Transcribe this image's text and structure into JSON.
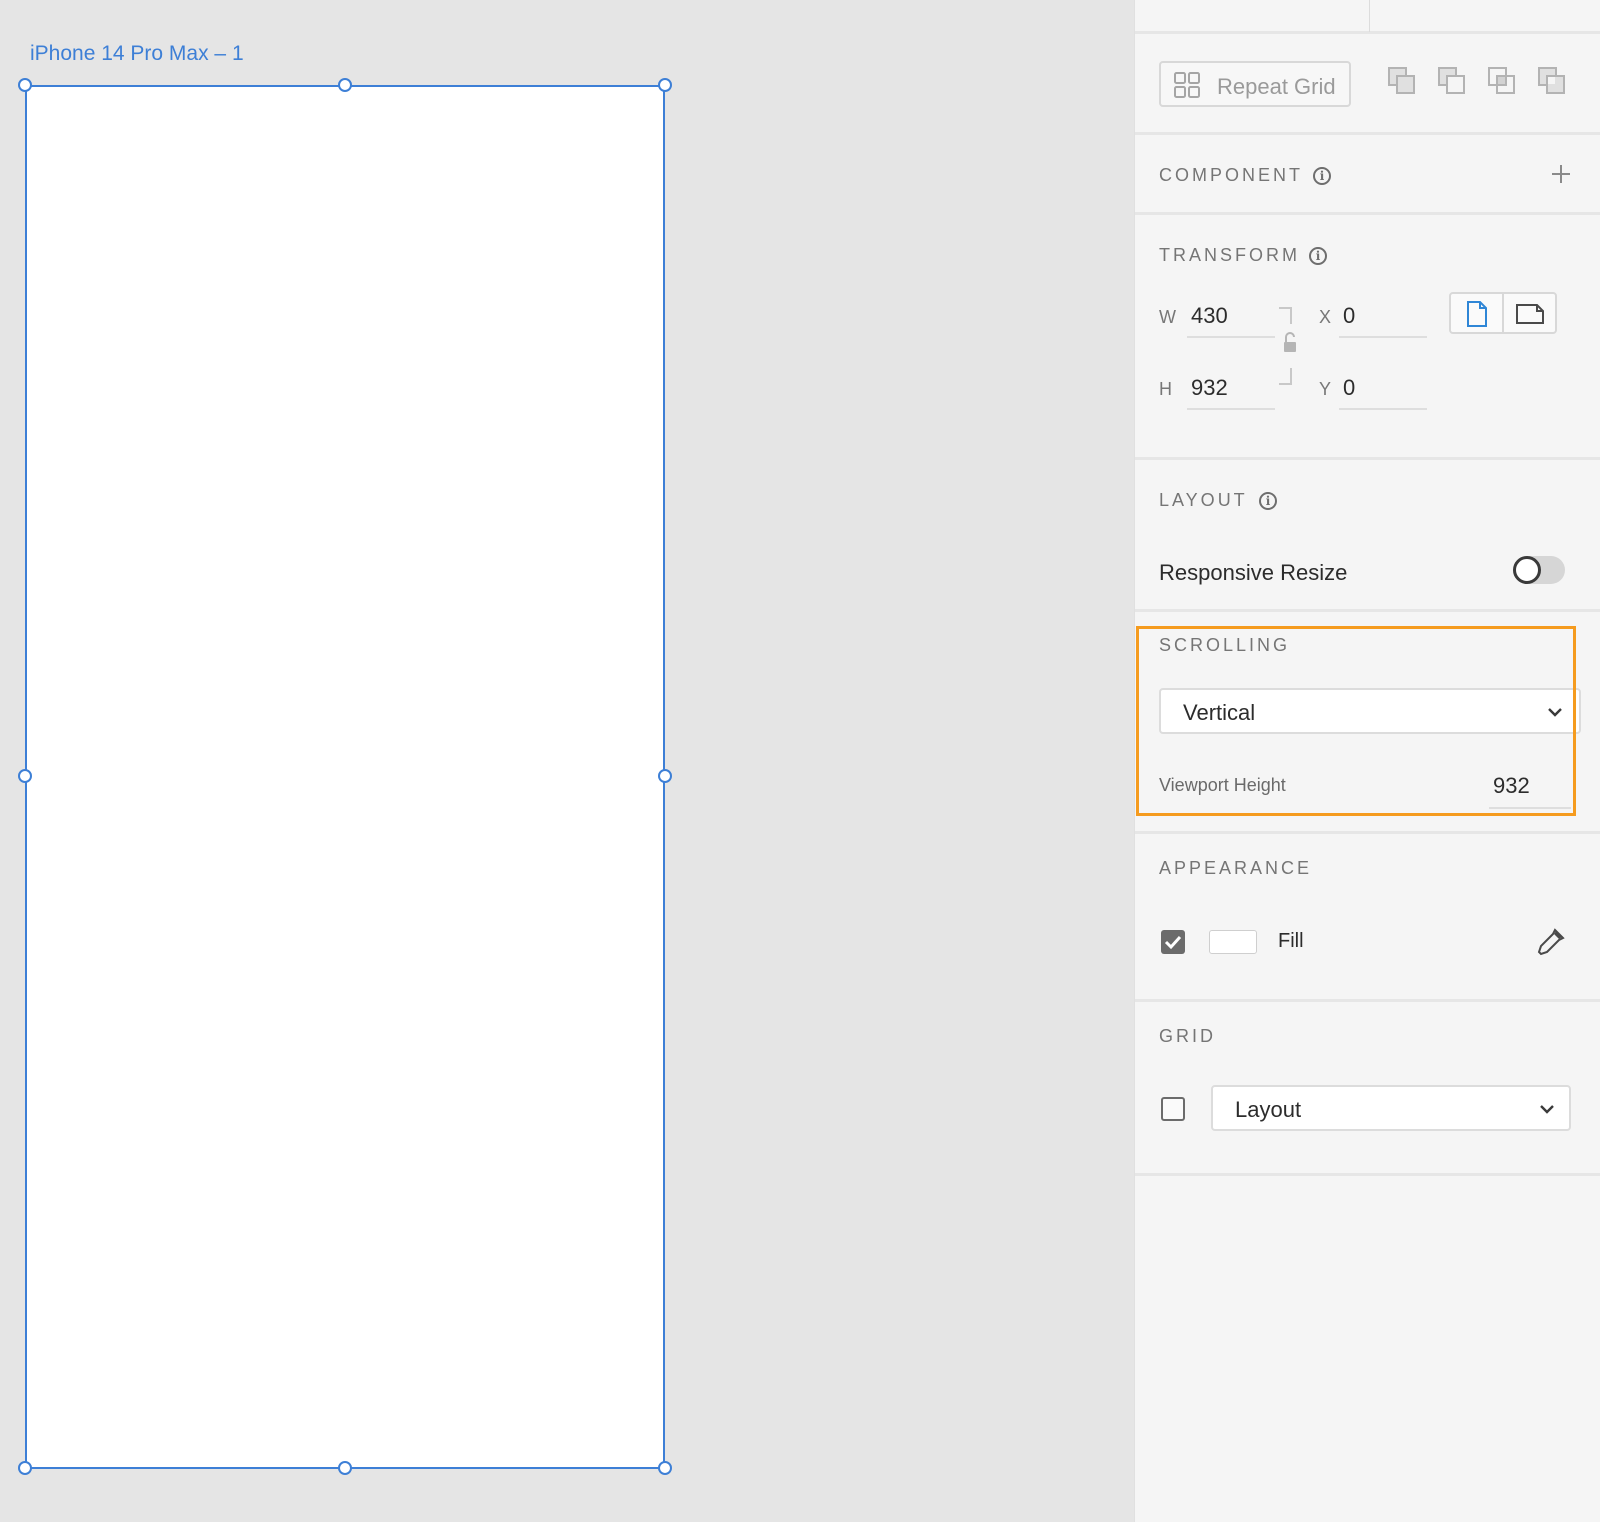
{
  "canvas": {
    "artboard_label": "iPhone 14 Pro Max – 1"
  },
  "panel": {
    "repeat_grid": {
      "label": "Repeat Grid"
    },
    "boolean_ops": [
      "add-icon",
      "subtract-icon",
      "intersect-icon",
      "exclude-icon"
    ],
    "component": {
      "title": "COMPONENT",
      "info_icon": "info-icon",
      "add_icon": "plus-icon"
    },
    "transform": {
      "title": "TRANSFORM",
      "w_label": "W",
      "w_value": "430",
      "h_label": "H",
      "h_value": "932",
      "x_label": "X",
      "x_value": "0",
      "y_label": "Y",
      "y_value": "0",
      "lock_icon": "unlocked-icon",
      "orientation": {
        "selected": "portrait"
      }
    },
    "layout": {
      "title": "LAYOUT",
      "responsive_resize_label": "Responsive Resize",
      "responsive_resize_on": false
    },
    "scrolling": {
      "title": "SCROLLING",
      "mode": "Vertical",
      "viewport_height_label": "Viewport Height",
      "viewport_height_value": "932"
    },
    "appearance": {
      "title": "APPEARANCE",
      "fill_checked": true,
      "fill_label": "Fill",
      "fill_color": "#ffffff",
      "eyedropper_icon": "eyedropper-icon"
    },
    "grid": {
      "title": "GRID",
      "checked": false,
      "type": "Layout"
    }
  },
  "colors": {
    "accent_blue": "#3d7fd6",
    "highlight_orange": "#f59b1e",
    "panel_bg": "#f5f5f5",
    "canvas_bg": "#e5e5e5"
  }
}
